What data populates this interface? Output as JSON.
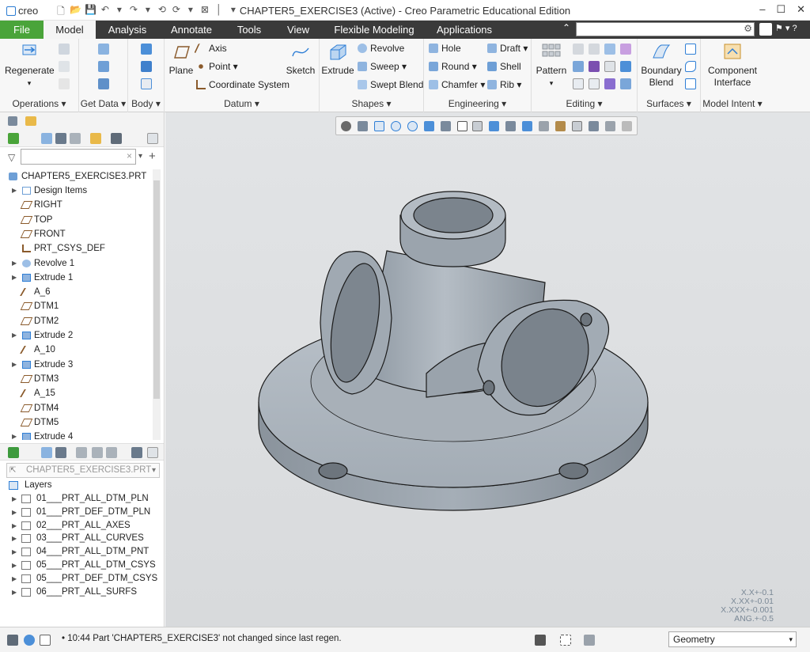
{
  "app": {
    "logo": "creo",
    "title": "CHAPTER5_EXERCISE3 (Active) - Creo Parametric Educational Edition",
    "controls": [
      "–",
      "☐",
      "✕"
    ]
  },
  "qat": [
    "🗋",
    "📂",
    "💾",
    "↶",
    "▾",
    "↷",
    "▾",
    "⟲",
    "⟳",
    "▾",
    "⊠",
    "▾",
    "│",
    "▾"
  ],
  "tabs": [
    {
      "label": "File"
    },
    {
      "label": "Model"
    },
    {
      "label": "Analysis"
    },
    {
      "label": "Annotate"
    },
    {
      "label": "Tools"
    },
    {
      "label": "View"
    },
    {
      "label": "Flexible Modeling"
    },
    {
      "label": "Applications"
    }
  ],
  "groups": {
    "operations": "Operations ▾",
    "get_data": "Get Data ▾",
    "body": "Body ▾",
    "datum": "Datum ▾",
    "shapes": "Shapes ▾",
    "engineering": "Engineering ▾",
    "editing": "Editing ▾",
    "surfaces": "Surfaces ▾",
    "model_intent": "Model Intent ▾"
  },
  "buttons": {
    "regenerate": "Regenerate",
    "plane": "Plane",
    "axis": "Axis",
    "point": "Point ▾",
    "csys": "Coordinate System",
    "sketch": "Sketch",
    "extrude": "Extrude",
    "revolve": "Revolve",
    "sweep": "Sweep ▾",
    "swept_blend": "Swept Blend",
    "hole": "Hole",
    "draft": "Draft ▾",
    "round": "Round ▾",
    "shell": "Shell",
    "chamfer": "Chamfer ▾",
    "rib": "Rib ▾",
    "pattern": "Pattern",
    "boundary_blend": "Boundary Blend",
    "component_interface": "Component Interface"
  },
  "tree": {
    "root": "CHAPTER5_EXERCISE3.PRT",
    "items": [
      {
        "label": "Design Items",
        "exp": true,
        "icon": "table"
      },
      {
        "label": "RIGHT",
        "exp": false,
        "icon": "plane"
      },
      {
        "label": "TOP",
        "exp": false,
        "icon": "plane"
      },
      {
        "label": "FRONT",
        "exp": false,
        "icon": "plane"
      },
      {
        "label": "PRT_CSYS_DEF",
        "exp": false,
        "icon": "csys"
      },
      {
        "label": "Revolve 1",
        "exp": true,
        "icon": "revolve"
      },
      {
        "label": "Extrude 1",
        "exp": true,
        "icon": "extrude"
      },
      {
        "label": "A_6",
        "exp": false,
        "icon": "axis"
      },
      {
        "label": "DTM1",
        "exp": false,
        "icon": "plane"
      },
      {
        "label": "DTM2",
        "exp": false,
        "icon": "plane"
      },
      {
        "label": "Extrude 2",
        "exp": true,
        "icon": "extrude"
      },
      {
        "label": "A_10",
        "exp": false,
        "icon": "axis"
      },
      {
        "label": "Extrude 3",
        "exp": true,
        "icon": "extrude"
      },
      {
        "label": "DTM3",
        "exp": false,
        "icon": "plane"
      },
      {
        "label": "A_15",
        "exp": false,
        "icon": "axis"
      },
      {
        "label": "DTM4",
        "exp": false,
        "icon": "plane"
      },
      {
        "label": "DTM5",
        "exp": false,
        "icon": "plane"
      },
      {
        "label": "Extrude 4",
        "exp": true,
        "icon": "extrude"
      }
    ]
  },
  "layers": {
    "selector": "CHAPTER5_EXERCISE3.PRT",
    "title": "Layers",
    "items": [
      "01___PRT_ALL_DTM_PLN",
      "01___PRT_DEF_DTM_PLN",
      "02___PRT_ALL_AXES",
      "03___PRT_ALL_CURVES",
      "04___PRT_ALL_DTM_PNT",
      "05___PRT_ALL_DTM_CSYS",
      "05___PRT_DEF_DTM_CSYS",
      "06___PRT_ALL_SURFS"
    ]
  },
  "tolerances": [
    "X.X+-0.1",
    "X.XX+-0.01",
    "X.XXX+-0.001",
    "ANG.+-0.5"
  ],
  "status": {
    "message": "• 10:44 Part 'CHAPTER5_EXERCISE3' not changed since last regen.",
    "filter": "Geometry"
  },
  "colors": {
    "ribbon_dark": "#3a3a3a",
    "file_tab": "#4aa43a",
    "model_body": "#9aa4af",
    "icon_blue": "#2f7fd6"
  }
}
